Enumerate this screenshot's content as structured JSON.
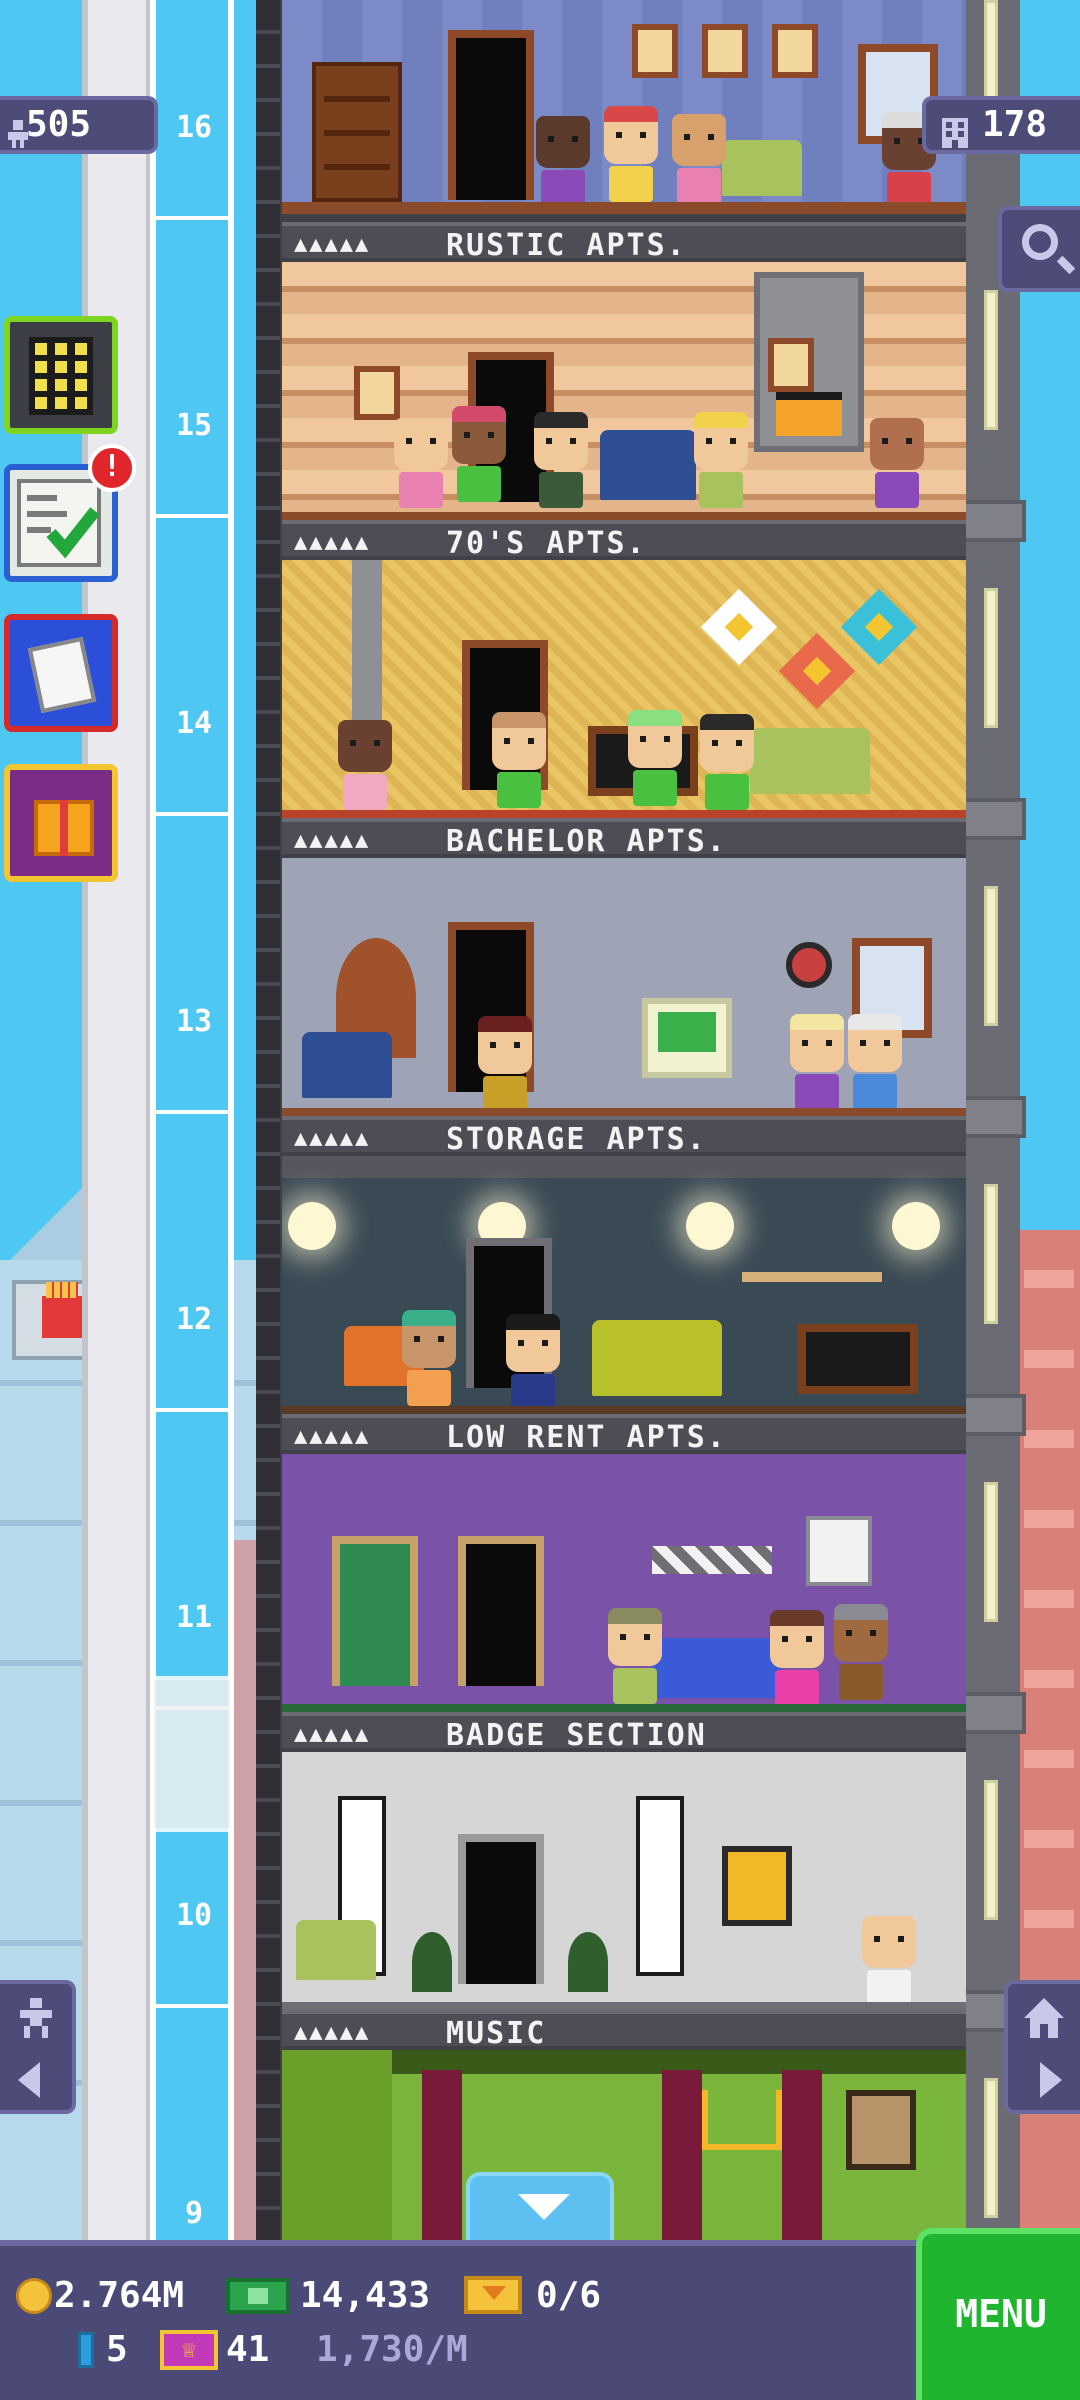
{
  "hud": {
    "population": "505",
    "floors_count": "178"
  },
  "side_buttons": {
    "missions_alert": "!"
  },
  "elevator": {
    "floor_numbers": [
      "16",
      "15",
      "14",
      "13",
      "12",
      "11",
      "10",
      "9"
    ]
  },
  "floors": [
    {
      "name": "RUSTIC APTS.",
      "stars": "▲▲▲▲▲"
    },
    {
      "name": "70'S APTS.",
      "stars": "▲▲▲▲▲"
    },
    {
      "name": "BACHELOR APTS.",
      "stars": "▲▲▲▲▲"
    },
    {
      "name": "STORAGE APTS.",
      "stars": "▲▲▲▲▲"
    },
    {
      "name": "LOW RENT APTS.",
      "stars": "▲▲▲▲▲"
    },
    {
      "name": "BADGE SECTION",
      "stars": "▲▲▲▲▲"
    },
    {
      "name": "MUSIC",
      "stars": "▲▲▲▲▲"
    }
  ],
  "bottom_bar": {
    "coins": "2.764M",
    "bux": "14,433",
    "tickets": "0/6",
    "tokens": "5",
    "vip": "41",
    "rate": "1,730/M",
    "menu_label": "MENU"
  },
  "colors": {
    "sky": "#4fc7f3",
    "hud_panel": "#4d4b78",
    "menu_green": "#1fb52f",
    "alert_red": "#e0262b"
  }
}
